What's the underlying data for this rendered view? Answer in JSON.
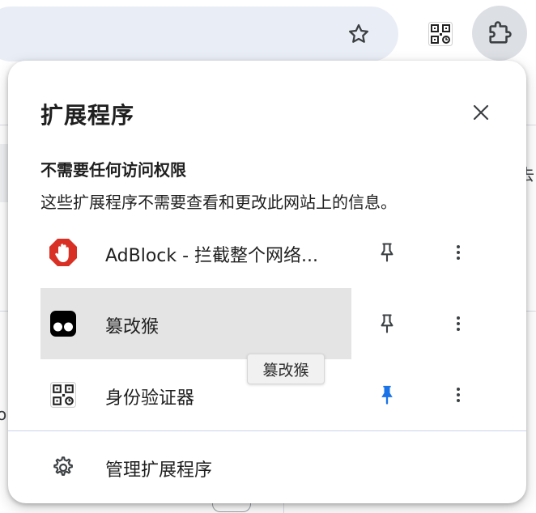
{
  "popup": {
    "title": "扩展程序",
    "section_heading": "不需要任何访问权限",
    "section_desc": "这些扩展程序不需要查看和更改此网站上的信息。",
    "extensions": [
      {
        "name": "AdBlock - 拦截整个网络...",
        "icon": "adblock-hand-icon",
        "pinned": false
      },
      {
        "name": "篡改猴",
        "icon": "tampermonkey-icon",
        "pinned": false,
        "hovered": true
      },
      {
        "name": "身份验证器",
        "icon": "qr-code-icon",
        "pinned": true
      }
    ],
    "manage_label": "管理扩展程序"
  },
  "tooltip": {
    "text": "篡改猴"
  },
  "background": {
    "right_fragment": "去",
    "left_fragment": "o"
  },
  "colors": {
    "pin_active": "#1a73e8",
    "adblock_red": "#d93025",
    "hover_row": "#e4e4e4",
    "extensions_button_bg": "#dcdfe4"
  }
}
